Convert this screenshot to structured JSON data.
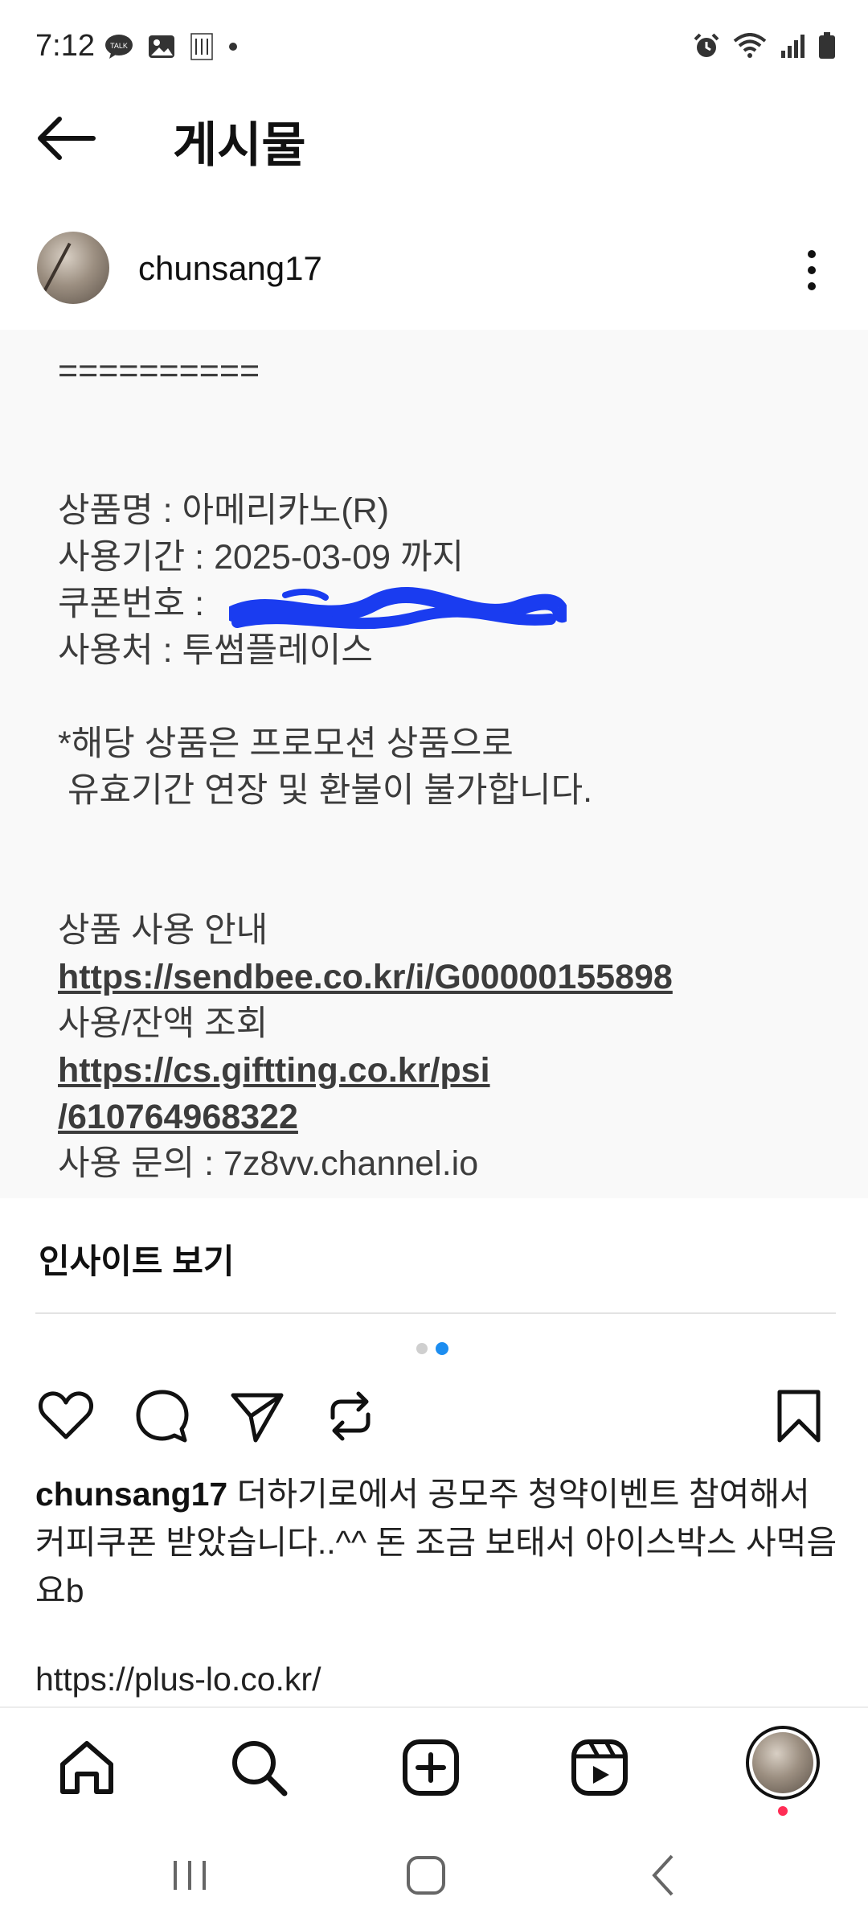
{
  "status_bar": {
    "time": "7:12",
    "left_icons": [
      "talk-icon",
      "gallery-icon",
      "innisfree-icon",
      "dot-icon"
    ],
    "right_icons": [
      "alarm-icon",
      "wifi-icon",
      "signal-icon",
      "battery-icon"
    ]
  },
  "header": {
    "title": "게시물"
  },
  "post": {
    "author": "chunsang17",
    "image_lines": [
      "==========",
      "",
      "",
      "상품명 : 아메리카노(R)",
      "사용기간 : 2025-03-09 까지",
      "쿠폰번호 : ",
      "사용처 : 투썸플레이스",
      "",
      "*해당 상품은 프로모션 상품으로",
      " 유효기간 연장 및 환불이 불가합니다.",
      "",
      "",
      "상품 사용 안내"
    ],
    "link_1": "https://sendbee.co.kr/i/G00000155898",
    "balance_label": "사용/잔액 조회",
    "link_2a": "https://cs.giftting.co.kr/psi",
    "link_2b": "/610764968322",
    "cutoff_line": "사용 문의 : 7z8vv.channel.io",
    "insights_label": "인사이트 보기",
    "carousel": {
      "count": 2,
      "active_index": 1
    },
    "caption_user": "chunsang17",
    "caption_text": " 더하기로에서 공모주 청약이벤트 참여해서 커피쿠폰 받았습니다..^^ 돈 조금 보태서 아이스박스 사먹음요b",
    "caption_link": "https://plus-lo.co.kr/"
  },
  "colors": {
    "accent": "#1c8df0",
    "notification": "#ff2d55",
    "scribble": "#1a3cf0",
    "image_bg": "#f9f9f9"
  }
}
